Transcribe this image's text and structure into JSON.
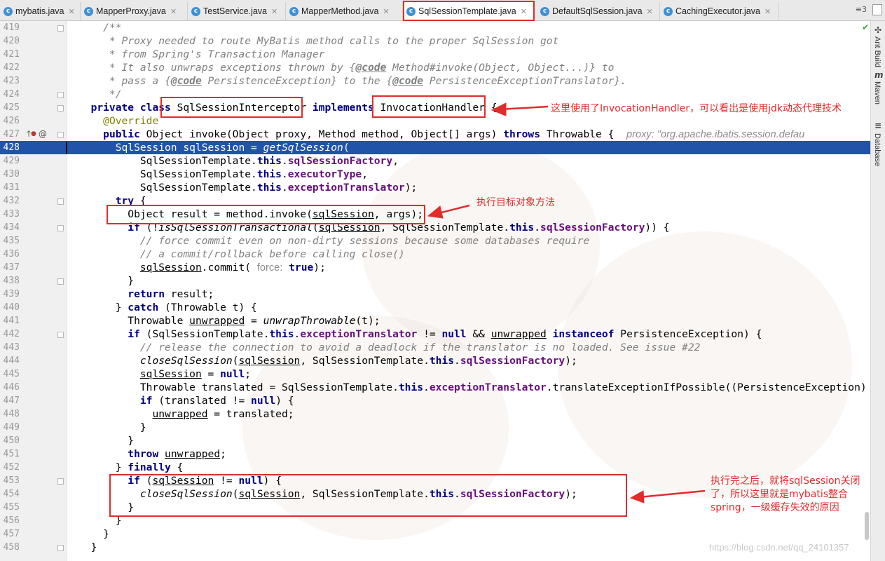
{
  "tabs": [
    {
      "label": "mybatis.java",
      "icon": "java-file-icon",
      "active": false
    },
    {
      "label": "MapperProxy.java",
      "icon": "class-icon",
      "active": false
    },
    {
      "label": "TestService.java",
      "icon": "class-icon",
      "active": false
    },
    {
      "label": "MapperMethod.java",
      "icon": "class-icon",
      "active": false
    },
    {
      "label": "SqlSessionTemplate.java",
      "icon": "class-icon",
      "active": true
    },
    {
      "label": "DefaultSqlSession.java",
      "icon": "class-icon",
      "active": false
    },
    {
      "label": "CachingExecutor.java",
      "icon": "class-icon",
      "active": false
    }
  ],
  "tab_overflow": "≡3",
  "right_toolbar": [
    "Ant Build",
    "Maven",
    "Database"
  ],
  "lines": [
    {
      "n": "419",
      "html": "    <span class=\"cm\">/**</span>"
    },
    {
      "n": "420",
      "html": "<span class=\"cm\">     * Proxy needed to route MyBatis method calls to the proper SqlSession got</span>"
    },
    {
      "n": "421",
      "html": "<span class=\"cm\">     * from Spring's Transaction Manager</span>"
    },
    {
      "n": "422",
      "html": "<span class=\"cm\">     * It also unwraps exceptions thrown by {</span><span class=\"dt\">@code</span><span class=\"cm\"> Method#invoke(Object, Object...)} to</span>"
    },
    {
      "n": "423",
      "html": "<span class=\"cm\">     * pass a {</span><span class=\"dt\">@code</span><span class=\"cm\"> PersistenceException} to the {</span><span class=\"dt\">@code</span><span class=\"cm\"> PersistenceExceptionTranslator}.</span>"
    },
    {
      "n": "424",
      "html": "<span class=\"cm\">     */</span>"
    },
    {
      "n": "425",
      "html": "  <span class=\"kw\">private class</span> SqlSessionInterceptor <span class=\"kw\">implements</span> InvocationHandler {"
    },
    {
      "n": "426",
      "html": "    <span class=\"ann\">@Override</span>"
    },
    {
      "n": "427",
      "html": "    <span class=\"kw\">public</span> Object invoke(Object proxy, Method method, Object[] args) <span class=\"kw\">throws</span> Throwable {  <span class=\"hint\">proxy: \"org.apache.ibatis.session.defau</span>"
    },
    {
      "n": "428",
      "html": "      SqlSession sqlSession = <span class=\"it\">getSqlSession</span>("
    },
    {
      "n": "429",
      "html": "          SqlSessionTemplate.<span class=\"kw\">this</span>.<span class=\"fld\">sqlSessionFactory</span>,"
    },
    {
      "n": "430",
      "html": "          SqlSessionTemplate.<span class=\"kw\">this</span>.<span class=\"fld\">executorType</span>,"
    },
    {
      "n": "431",
      "html": "          SqlSessionTemplate.<span class=\"kw\">this</span>.<span class=\"fld\">exceptionTranslator</span>);"
    },
    {
      "n": "432",
      "html": "      <span class=\"kw\">try</span> {"
    },
    {
      "n": "433",
      "html": "        Object result = method.invoke(<span class=\"ul\">sqlSession</span>, args);"
    },
    {
      "n": "434",
      "html": "        <span class=\"kw\">if</span> (!<span class=\"it\">isSqlSessionTransactional</span>(<span class=\"ul\">sqlSession</span>, SqlSessionTemplate.<span class=\"kw\">this</span>.<span class=\"fld\">sqlSessionFactory</span>)) {"
    },
    {
      "n": "435",
      "html": "<span class=\"cm\">          // force commit even on non-dirty sessions because some databases require</span>"
    },
    {
      "n": "436",
      "html": "<span class=\"cm\">          // a commit/rollback before calling close()</span>"
    },
    {
      "n": "437",
      "html": "          <span class=\"ul\">sqlSession</span>.commit( <span class=\"hint2\">force:</span> <span class=\"kw\">true</span>);"
    },
    {
      "n": "438",
      "html": "        }"
    },
    {
      "n": "439",
      "html": "        <span class=\"kw\">return</span> result;"
    },
    {
      "n": "440",
      "html": "      } <span class=\"kw\">catch</span> (Throwable t) {"
    },
    {
      "n": "441",
      "html": "        Throwable <span class=\"ul\">unwrapped</span> = <span class=\"it\">unwrapThrowable</span>(t);"
    },
    {
      "n": "442",
      "html": "        <span class=\"kw\">if</span> (SqlSessionTemplate.<span class=\"kw\">this</span>.<span class=\"fld\">exceptionTranslator</span> != <span class=\"kw\">null</span> &amp;&amp; <span class=\"ul\">unwrapped</span> <span class=\"kw\">instanceof</span> PersistenceException) {"
    },
    {
      "n": "443",
      "html": "<span class=\"cm\">          // release the connection to avoid a deadlock if the translator is no loaded. See issue #22</span>"
    },
    {
      "n": "444",
      "html": "          <span class=\"it\">closeSqlSession</span>(<span class=\"ul\">sqlSession</span>, SqlSessionTemplate.<span class=\"kw\">this</span>.<span class=\"fld\">sqlSessionFactory</span>);"
    },
    {
      "n": "445",
      "html": "          <span class=\"ul\">sqlSession</span> = <span class=\"kw\">null</span>;"
    },
    {
      "n": "446",
      "html": "          Throwable translated = SqlSessionTemplate.<span class=\"kw\">this</span>.<span class=\"fld\">exceptionTranslator</span>.translateExceptionIfPossible((PersistenceException)"
    },
    {
      "n": "447",
      "html": "          <span class=\"kw\">if</span> (translated != <span class=\"kw\">null</span>) {"
    },
    {
      "n": "448",
      "html": "            <span class=\"ul\">unwrapped</span> = translated;"
    },
    {
      "n": "449",
      "html": "          }"
    },
    {
      "n": "450",
      "html": "        }"
    },
    {
      "n": "451",
      "html": "        <span class=\"kw\">throw</span> <span class=\"ul\">unwrapped</span>;"
    },
    {
      "n": "452",
      "html": "      } <span class=\"kw\">finally</span> {"
    },
    {
      "n": "453",
      "html": "        <span class=\"kw\">if</span> (<span class=\"ul\">sqlSession</span> != <span class=\"kw\">null</span>) {"
    },
    {
      "n": "454",
      "html": "          <span class=\"it\">closeSqlSession</span>(<span class=\"ul\">sqlSession</span>, SqlSessionTemplate.<span class=\"kw\">this</span>.<span class=\"fld\">sqlSessionFactory</span>);"
    },
    {
      "n": "455",
      "html": "        }"
    },
    {
      "n": "456",
      "html": "      }"
    },
    {
      "n": "457",
      "html": "    }"
    },
    {
      "n": "458",
      "html": "  }"
    }
  ],
  "highlighted_line": "428",
  "annotations": {
    "invocation_handler_note": "这里使用了InvocationHandler，可以看出是使用jdk动态代理技术",
    "invoke_note": "执行目标对象方法",
    "close_note_line1": "执行完之后，就将sqlSession关闭",
    "close_note_line2": "了，所以这里就是mybatis整合",
    "close_note_line3": "spring，一级缓存失效的原因"
  },
  "watermark": "https://blog.csdn.net/qq_24101357",
  "colors": {
    "highlight": "#2154a9",
    "keyword": "#000080",
    "field": "#660e7a",
    "comment": "#808080",
    "annotation_red": "#e42b2b"
  }
}
